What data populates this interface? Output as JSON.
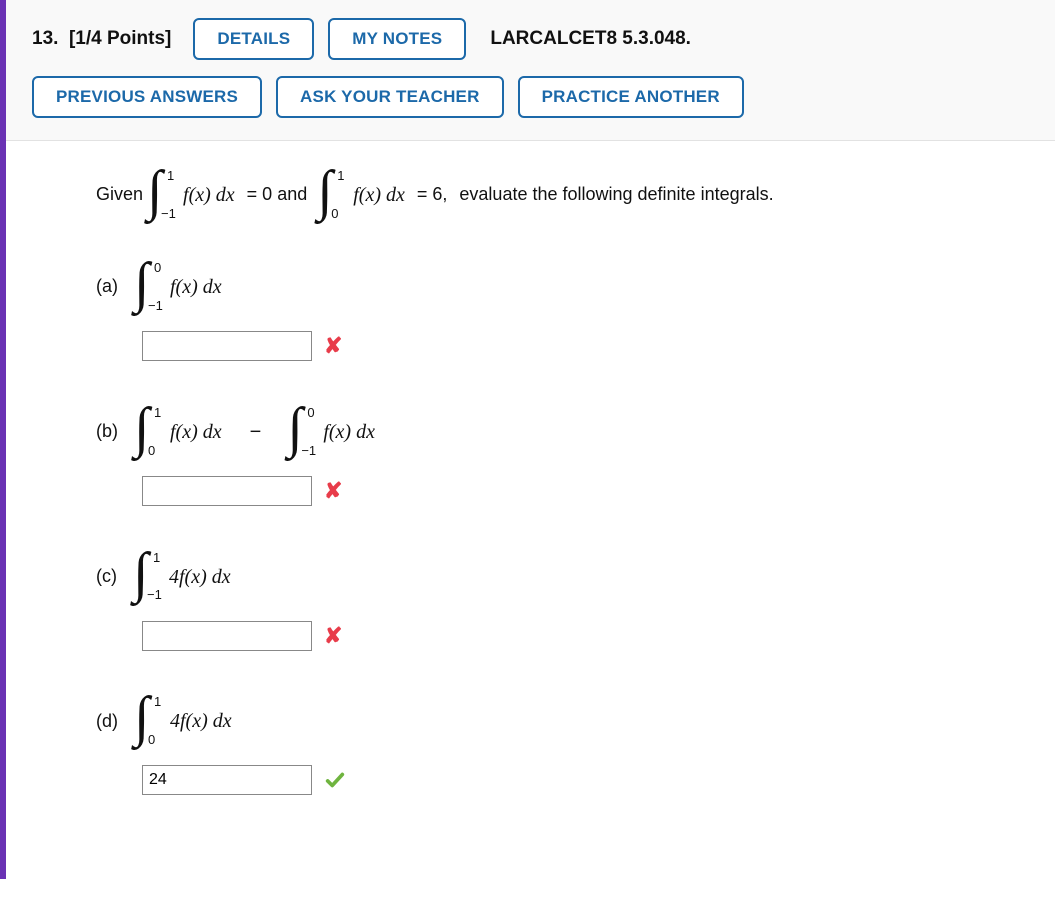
{
  "header": {
    "question_number": "13.",
    "points": "[1/4 Points]",
    "details_label": "DETAILS",
    "notes_label": "MY NOTES",
    "reference": "LARCALCET8 5.3.048.",
    "previous_label": "PREVIOUS ANSWERS",
    "ask_label": "ASK YOUR TEACHER",
    "practice_label": "PRACTICE ANOTHER"
  },
  "given": {
    "lead": "Given",
    "int1": {
      "upper": "1",
      "lower": "−1",
      "body": "f(x) dx"
    },
    "eq1": "= 0 and",
    "int2": {
      "upper": "1",
      "lower": "0",
      "body": "f(x) dx"
    },
    "eq2": "= 6,",
    "tail": "evaluate the following definite integrals."
  },
  "parts": {
    "a": {
      "label": "(a)",
      "int1": {
        "upper": "0",
        "lower": "−1",
        "body": "f(x) dx"
      },
      "value": "",
      "mark": "wrong"
    },
    "b": {
      "label": "(b)",
      "int1": {
        "upper": "1",
        "lower": "0",
        "body": "f(x) dx"
      },
      "op": "−",
      "int2": {
        "upper": "0",
        "lower": "−1",
        "body": "f(x) dx"
      },
      "value": "",
      "mark": "wrong"
    },
    "c": {
      "label": "(c)",
      "int1": {
        "upper": "1",
        "lower": "−1",
        "body": "4f(x) dx"
      },
      "value": "",
      "mark": "wrong"
    },
    "d": {
      "label": "(d)",
      "int1": {
        "upper": "1",
        "lower": "0",
        "body": "4f(x) dx"
      },
      "value": "24",
      "mark": "correct"
    }
  }
}
